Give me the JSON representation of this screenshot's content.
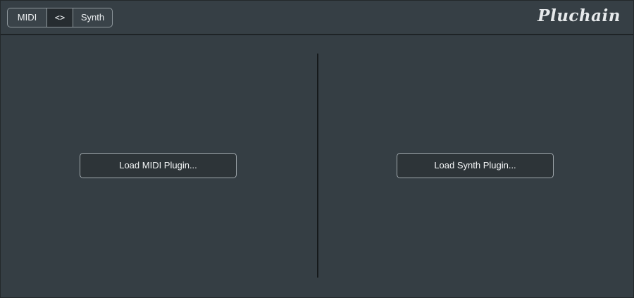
{
  "header": {
    "segments": {
      "midi_label": "MIDI",
      "link_label": "<>",
      "synth_label": "Synth"
    },
    "logo_text": "Pluchain"
  },
  "main": {
    "load_midi_label": "Load MIDI Plugin...",
    "load_synth_label": "Load Synth Plugin..."
  },
  "colors": {
    "background": "#353e44",
    "header_border": "#1e2326",
    "divider": "#15191b",
    "button_bg": "#2d3438",
    "button_border": "#a0a8ad",
    "text": "#f3f5f6"
  }
}
